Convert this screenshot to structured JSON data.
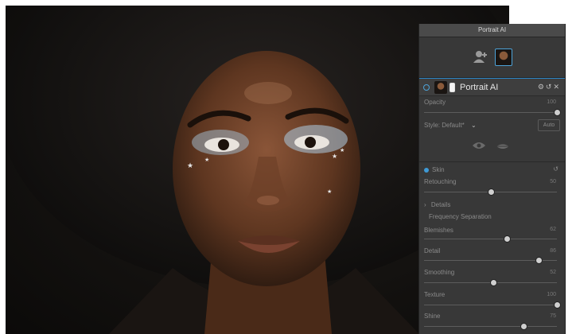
{
  "panel": {
    "title": "Portrait AI",
    "layer_name": "Portrait AI",
    "opacity_label": "Opacity",
    "opacity_value": "100",
    "opacity_level": 1.0,
    "style_label": "Style: Default*",
    "auto_label": "Auto",
    "skin_label": "Skin",
    "retouching_label": "Retouching",
    "retouching_value": "50",
    "retouching_level": 0.5,
    "details_label": "Details",
    "freq_sep_label": "Frequency Separation",
    "blemishes_label": "Blemishes",
    "blemishes_value": "62",
    "blemishes_level": 0.62,
    "detail_label": "Detail",
    "detail_value": "86",
    "detail_level": 0.86,
    "smoothing_label": "Smoothing",
    "smoothing_value": "52",
    "smoothing_level": 0.52,
    "texture_label": "Texture",
    "texture_value": "100",
    "texture_level": 1.0,
    "shine_label": "Shine",
    "shine_value": "75",
    "shine_level": 0.75,
    "icons": [
      "add-person-icon",
      "eye-icon",
      "lips-icon",
      "gear-icon",
      "reset-icon",
      "close-icon",
      "chevron-down-icon",
      "chevron-right-icon"
    ]
  },
  "colors": {
    "accent": "#4da3d9",
    "panel_bg": "#383838",
    "title_bg": "#4a4a4a"
  }
}
